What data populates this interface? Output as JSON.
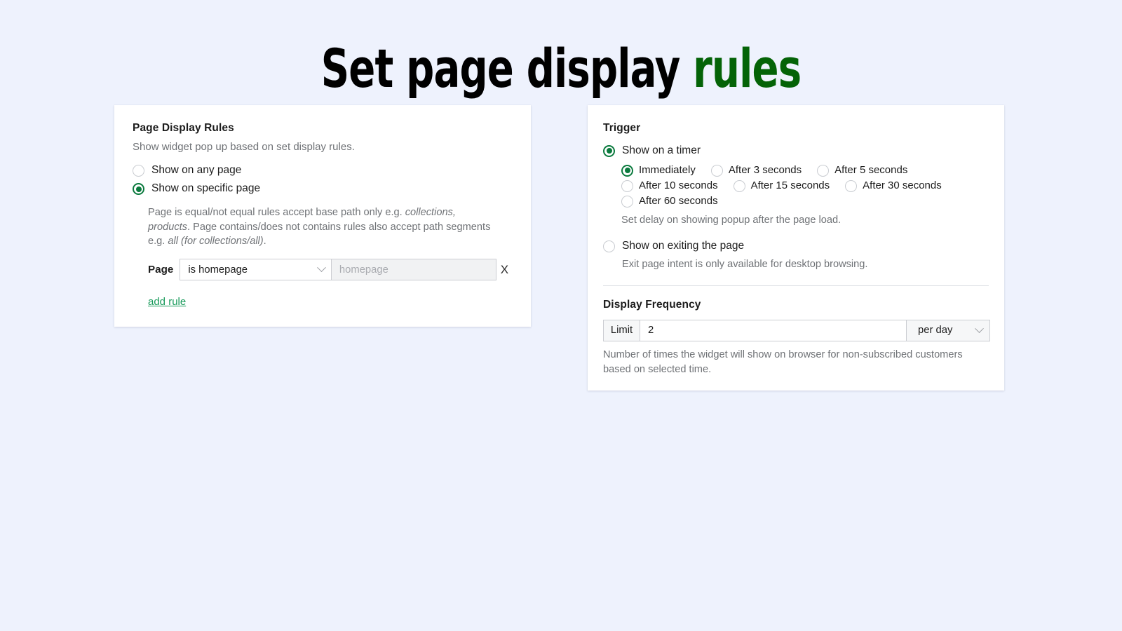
{
  "title": {
    "main": "Set page display ",
    "accent": "rules",
    "accent_color": "#046307"
  },
  "theme": {
    "page_background": "#eef2fd",
    "card_background": "#ffffff",
    "selected_radio": "#0b7a3e",
    "link_green": "#179a5a",
    "muted_text": "#6f7276"
  },
  "left_card": {
    "heading": "Page Display Rules",
    "subheading": "Show widget pop up based on set display rules.",
    "options": [
      {
        "label": "Show on any page",
        "selected": false
      },
      {
        "label": "Show on specific page",
        "selected": true
      }
    ],
    "helper_parts": {
      "p1": "Page is equal/not equal rules accept base path only e.g. ",
      "i1": "collections, products",
      "p2": ". Page contains/does not contains rules also accept path segments e.g. ",
      "i2": "all (for collections/all)",
      "p3": "."
    },
    "rule": {
      "label": "Page",
      "condition_value": "is homepage",
      "value_placeholder": "homepage",
      "value": "",
      "remove_label": "X"
    },
    "add_rule_label": "add rule"
  },
  "right_card": {
    "trigger_heading": "Trigger",
    "trigger_options": [
      {
        "label": "Show on a timer",
        "selected": true
      },
      {
        "label": "Show on exiting the page",
        "selected": false
      }
    ],
    "timer_options": [
      {
        "label": "Immediately",
        "selected": true
      },
      {
        "label": "After 3 seconds",
        "selected": false
      },
      {
        "label": "After 5 seconds",
        "selected": false
      },
      {
        "label": "After 10 seconds",
        "selected": false
      },
      {
        "label": "After 15 seconds",
        "selected": false
      },
      {
        "label": "After 30 seconds",
        "selected": false
      },
      {
        "label": "After 60 seconds",
        "selected": false
      }
    ],
    "timer_note": "Set delay on showing popup after the page load.",
    "exit_note": "Exit page intent is only available for desktop browsing.",
    "frequency_heading": "Display Frequency",
    "frequency": {
      "prefix_label": "Limit",
      "value": "2",
      "period_value": "per day"
    },
    "frequency_note": "Number of times the widget will show on browser for non-subscribed customers based on selected time."
  }
}
